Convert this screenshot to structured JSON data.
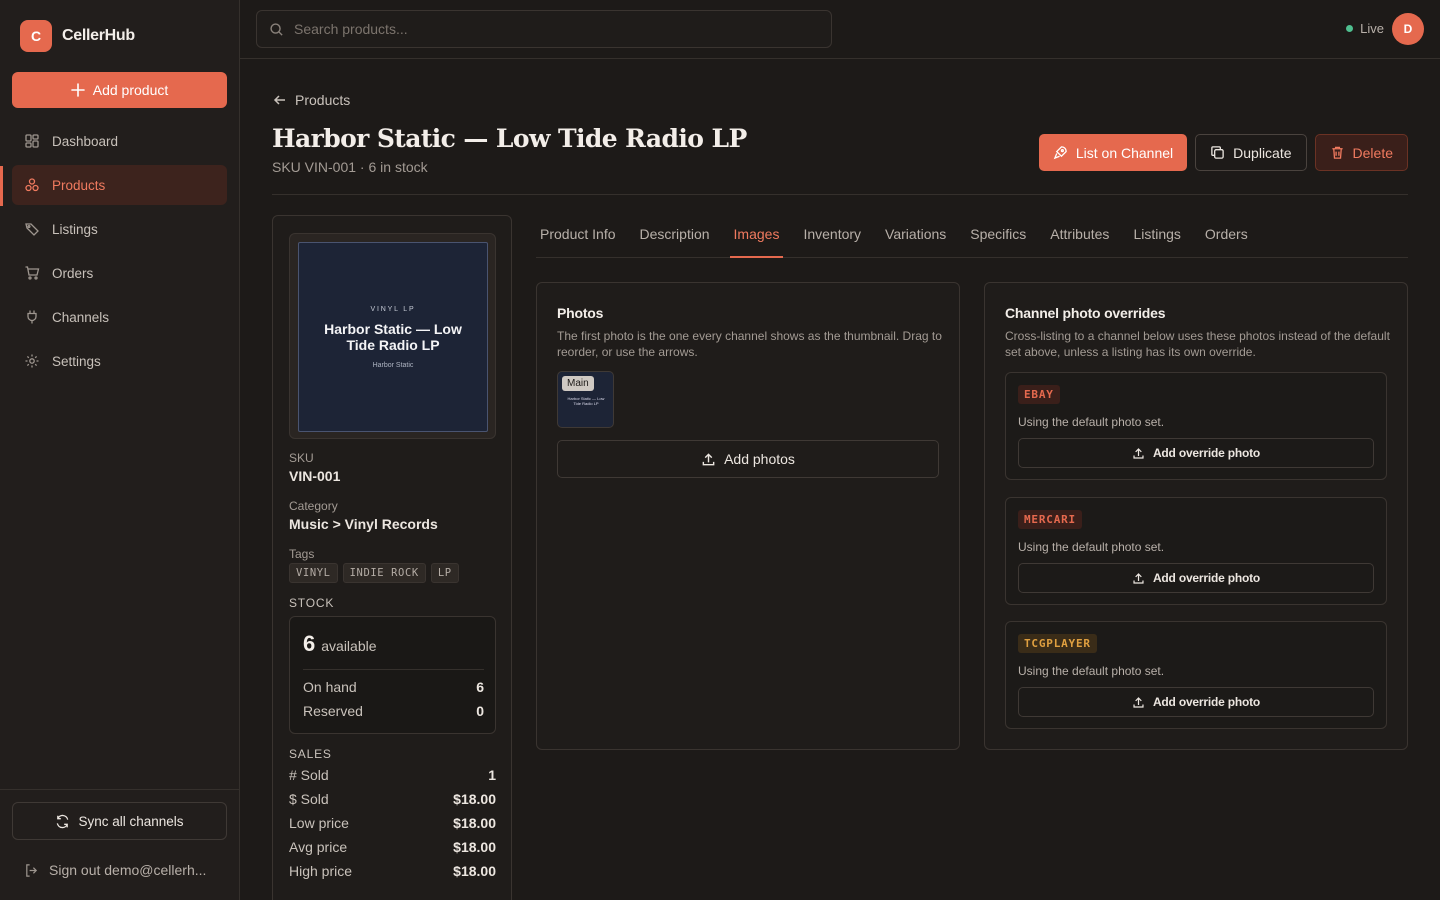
{
  "brand": {
    "logo_letter": "C",
    "name": "CellerHub"
  },
  "sidebar": {
    "add_product_label": "Add product",
    "items": [
      {
        "label": "Dashboard",
        "icon": "dashboard-icon"
      },
      {
        "label": "Products",
        "icon": "products-icon",
        "active": true
      },
      {
        "label": "Listings",
        "icon": "tag-icon"
      },
      {
        "label": "Orders",
        "icon": "cart-icon"
      },
      {
        "label": "Channels",
        "icon": "plug-icon"
      },
      {
        "label": "Settings",
        "icon": "gear-icon"
      }
    ],
    "sync_label": "Sync all channels",
    "signout_label": "Sign out demo@cellerh..."
  },
  "topbar": {
    "search_placeholder": "Search products...",
    "status": "Live",
    "avatar_letter": "D"
  },
  "header": {
    "breadcrumb": "Products",
    "title": "Harbor Static — Low Tide Radio LP",
    "subtitle": "SKU VIN-001 · 6 in stock",
    "actions": {
      "list": "List on Channel",
      "duplicate": "Duplicate",
      "delete": "Delete"
    }
  },
  "product": {
    "cover": {
      "kicker": "VINYL LP",
      "title": "Harbor Static — Low Tide Radio LP",
      "artist": "Harbor Static"
    },
    "sku_label": "SKU",
    "sku": "VIN-001",
    "category_label": "Category",
    "category": "Music > Vinyl Records",
    "tags_label": "Tags",
    "tags": [
      "VINYL",
      "INDIE ROCK",
      "LP"
    ],
    "stock_label": "STOCK",
    "stock": {
      "available": "6",
      "available_label": "available",
      "on_hand_label": "On hand",
      "on_hand": "6",
      "reserved_label": "Reserved",
      "reserved": "0"
    },
    "sales_label": "SALES",
    "sales": [
      {
        "label": "# Sold",
        "value": "1"
      },
      {
        "label": "$ Sold",
        "value": "$18.00"
      },
      {
        "label": "Low price",
        "value": "$18.00"
      },
      {
        "label": "Avg price",
        "value": "$18.00"
      },
      {
        "label": "High price",
        "value": "$18.00"
      }
    ]
  },
  "tabs": [
    "Product Info",
    "Description",
    "Images",
    "Inventory",
    "Variations",
    "Specifics",
    "Attributes",
    "Listings",
    "Orders"
  ],
  "active_tab": "Images",
  "photos": {
    "title": "Photos",
    "desc_line1": "The first photo is the one every channel shows as the thumbnail. Drag to",
    "desc_line2": "reorder, or use the arrows.",
    "main_badge": "Main",
    "thumb_text": "Harbor Static — Low Tide Radio LP",
    "add_label": "Add photos"
  },
  "overrides": {
    "title": "Channel photo overrides",
    "desc_line1": "Cross-listing to a channel below uses these photos instead of the default",
    "desc_line2": "set above, unless a listing has its own override.",
    "channels": [
      {
        "name": "EBAY",
        "status": "Using the default photo set.",
        "button": "Add override photo",
        "color": "#e5694e",
        "bg": "#3a1f1a"
      },
      {
        "name": "MERCARI",
        "status": "Using the default photo set.",
        "button": "Add override photo",
        "color": "#e5694e",
        "bg": "#3a1f1a"
      },
      {
        "name": "TCGPLAYER",
        "status": "Using the default photo set.",
        "button": "Add override photo",
        "color": "#e0a040",
        "bg": "#3a2c18"
      }
    ]
  },
  "colors": {
    "accent": "#e5694e",
    "live": "#4fbf8f",
    "background": "#1d1a18"
  }
}
